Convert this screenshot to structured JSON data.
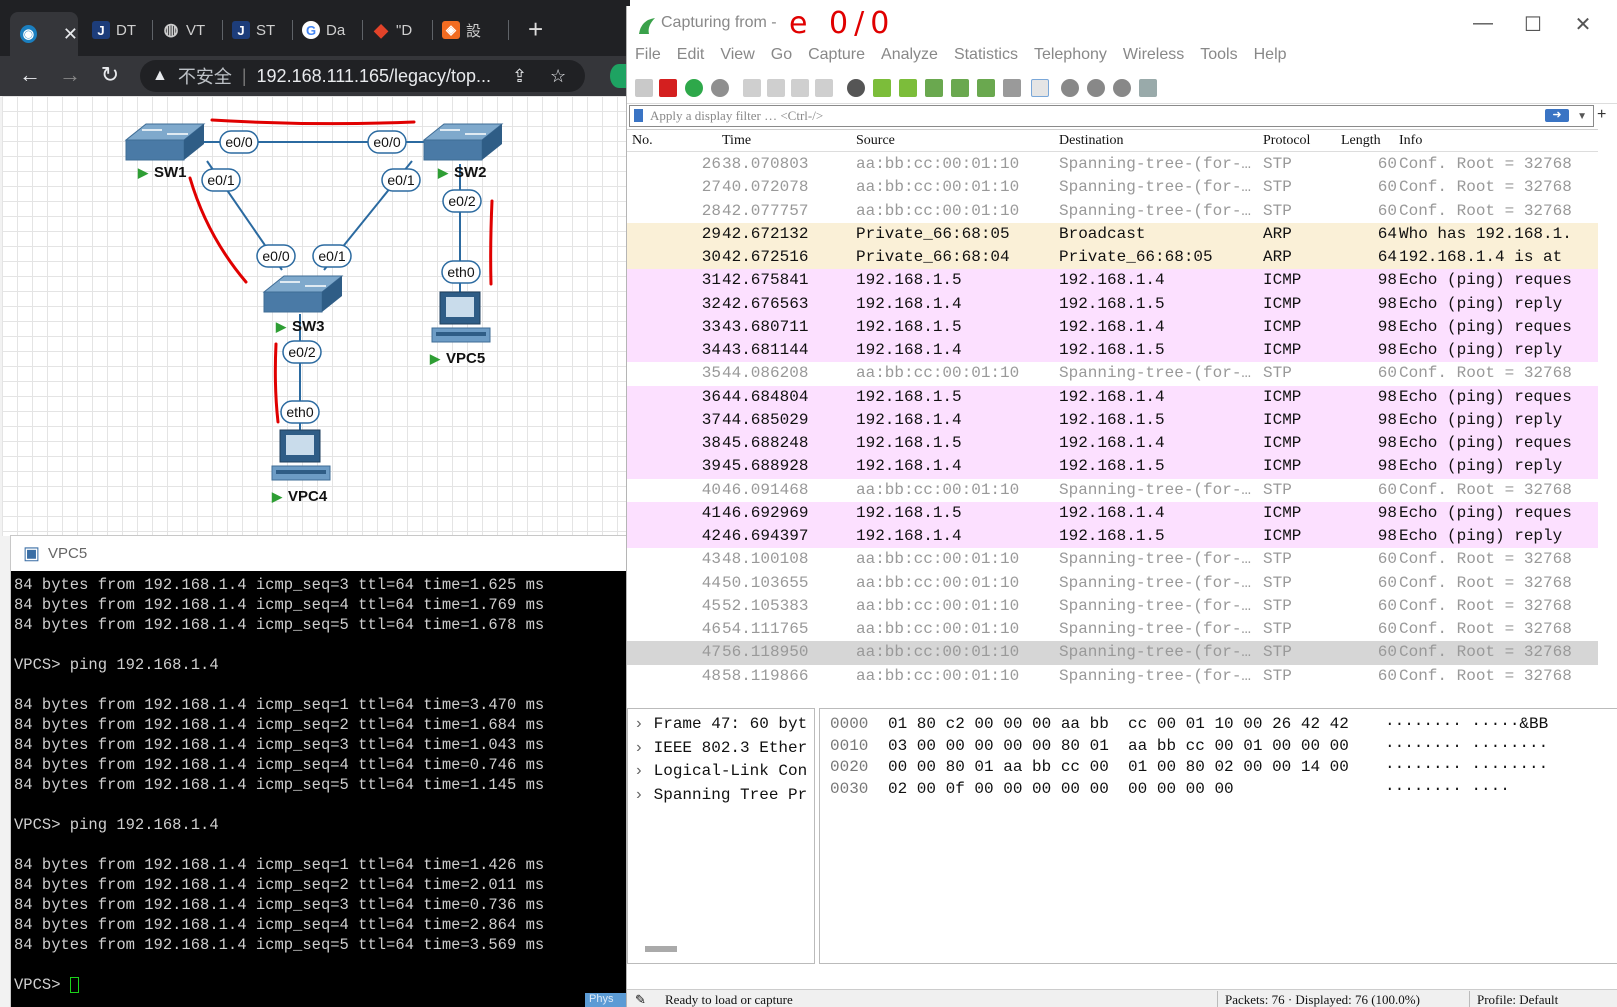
{
  "browser": {
    "tabs": [
      {
        "label": "",
        "icon": "eve-ng-icon"
      },
      {
        "label": "DT",
        "icon": "j-icon"
      },
      {
        "label": "VT",
        "icon": "globe-icon"
      },
      {
        "label": "ST",
        "icon": "j-icon"
      },
      {
        "label": "Da",
        "icon": "google-icon"
      },
      {
        "label": "\"D",
        "icon": "gitlab-icon"
      },
      {
        "label": "設",
        "icon": "orange-icon"
      }
    ],
    "insecure_label": "不安全",
    "url": "192.168.111.165/legacy/top..."
  },
  "topology": {
    "nodes": {
      "sw1": "SW1",
      "sw2": "SW2",
      "sw3": "SW3",
      "vpc5": "VPC5",
      "vpc4": "VPC4"
    },
    "ports": {
      "sw1_e00": "e0/0",
      "sw2_e00": "e0/0",
      "sw1_e01": "e0/1",
      "sw2_e01": "e0/1",
      "sw3_e00": "e0/0",
      "sw3_e01": "e0/1",
      "sw2_e02": "e0/2",
      "vpc5_eth0": "eth0",
      "sw3_e02": "e0/2",
      "vpc4_eth0": "eth0"
    },
    "colors": {
      "link": "#2b6aa0",
      "annotation": "#e00000",
      "running": "#2e9e34"
    }
  },
  "console": {
    "title": "VPC5",
    "lines": [
      "84 bytes from 192.168.1.4 icmp_seq=3 ttl=64 time=1.625 ms",
      "84 bytes from 192.168.1.4 icmp_seq=4 ttl=64 time=1.769 ms",
      "84 bytes from 192.168.1.4 icmp_seq=5 ttl=64 time=1.678 ms",
      "",
      "VPCS> ping 192.168.1.4",
      "",
      "84 bytes from 192.168.1.4 icmp_seq=1 ttl=64 time=3.470 ms",
      "84 bytes from 192.168.1.4 icmp_seq=2 ttl=64 time=1.684 ms",
      "84 bytes from 192.168.1.4 icmp_seq=3 ttl=64 time=1.043 ms",
      "84 bytes from 192.168.1.4 icmp_seq=4 ttl=64 time=0.746 ms",
      "84 bytes from 192.168.1.4 icmp_seq=5 ttl=64 time=1.145 ms",
      "",
      "VPCS> ping 192.168.1.4",
      "",
      "84 bytes from 192.168.1.4 icmp_seq=1 ttl=64 time=1.426 ms",
      "84 bytes from 192.168.1.4 icmp_seq=2 ttl=64 time=2.011 ms",
      "84 bytes from 192.168.1.4 icmp_seq=3 ttl=64 time=0.736 ms",
      "84 bytes from 192.168.1.4 icmp_seq=4 ttl=64 time=2.864 ms",
      "84 bytes from 192.168.1.4 icmp_seq=5 ttl=64 time=3.569 ms",
      ""
    ],
    "prompt": "VPCS> ",
    "phys_label": "Phys"
  },
  "wireshark": {
    "title": "Capturing from -",
    "handwritten_note": "e 0/0",
    "menu": [
      "File",
      "Edit",
      "View",
      "Go",
      "Capture",
      "Analyze",
      "Statistics",
      "Telephony",
      "Wireless",
      "Tools",
      "Help"
    ],
    "filter_placeholder": "Apply a display filter … <Ctrl-/>",
    "columns": [
      "No.",
      "Time",
      "Source",
      "Destination",
      "Protocol",
      "Length",
      "Info"
    ],
    "packets": [
      {
        "no": "26",
        "time": "38.070803",
        "src": "aa:bb:cc:00:01:10",
        "dst": "Spanning-tree-(for-…",
        "proto": "STP",
        "len": "60",
        "info": "Conf. Root = 32768",
        "kind": "stp"
      },
      {
        "no": "27",
        "time": "40.072078",
        "src": "aa:bb:cc:00:01:10",
        "dst": "Spanning-tree-(for-…",
        "proto": "STP",
        "len": "60",
        "info": "Conf. Root = 32768",
        "kind": "stp"
      },
      {
        "no": "28",
        "time": "42.077757",
        "src": "aa:bb:cc:00:01:10",
        "dst": "Spanning-tree-(for-…",
        "proto": "STP",
        "len": "60",
        "info": "Conf. Root = 32768",
        "kind": "stp"
      },
      {
        "no": "29",
        "time": "42.672132",
        "src": "Private_66:68:05",
        "dst": "Broadcast",
        "proto": "ARP",
        "len": "64",
        "info": "Who has 192.168.1.",
        "kind": "arp"
      },
      {
        "no": "30",
        "time": "42.672516",
        "src": "Private_66:68:04",
        "dst": "Private_66:68:05",
        "proto": "ARP",
        "len": "64",
        "info": "192.168.1.4 is at",
        "kind": "arp"
      },
      {
        "no": "31",
        "time": "42.675841",
        "src": "192.168.1.5",
        "dst": "192.168.1.4",
        "proto": "ICMP",
        "len": "98",
        "info": "Echo (ping) reques",
        "kind": "icmp"
      },
      {
        "no": "32",
        "time": "42.676563",
        "src": "192.168.1.4",
        "dst": "192.168.1.5",
        "proto": "ICMP",
        "len": "98",
        "info": "Echo (ping) reply",
        "kind": "icmp"
      },
      {
        "no": "33",
        "time": "43.680711",
        "src": "192.168.1.5",
        "dst": "192.168.1.4",
        "proto": "ICMP",
        "len": "98",
        "info": "Echo (ping) reques",
        "kind": "icmp"
      },
      {
        "no": "34",
        "time": "43.681144",
        "src": "192.168.1.4",
        "dst": "192.168.1.5",
        "proto": "ICMP",
        "len": "98",
        "info": "Echo (ping) reply",
        "kind": "icmp"
      },
      {
        "no": "35",
        "time": "44.086208",
        "src": "aa:bb:cc:00:01:10",
        "dst": "Spanning-tree-(for-…",
        "proto": "STP",
        "len": "60",
        "info": "Conf. Root = 32768",
        "kind": "stp"
      },
      {
        "no": "36",
        "time": "44.684804",
        "src": "192.168.1.5",
        "dst": "192.168.1.4",
        "proto": "ICMP",
        "len": "98",
        "info": "Echo (ping) reques",
        "kind": "icmp"
      },
      {
        "no": "37",
        "time": "44.685029",
        "src": "192.168.1.4",
        "dst": "192.168.1.5",
        "proto": "ICMP",
        "len": "98",
        "info": "Echo (ping) reply",
        "kind": "icmp"
      },
      {
        "no": "38",
        "time": "45.688248",
        "src": "192.168.1.5",
        "dst": "192.168.1.4",
        "proto": "ICMP",
        "len": "98",
        "info": "Echo (ping) reques",
        "kind": "icmp"
      },
      {
        "no": "39",
        "time": "45.688928",
        "src": "192.168.1.4",
        "dst": "192.168.1.5",
        "proto": "ICMP",
        "len": "98",
        "info": "Echo (ping) reply",
        "kind": "icmp"
      },
      {
        "no": "40",
        "time": "46.091468",
        "src": "aa:bb:cc:00:01:10",
        "dst": "Spanning-tree-(for-…",
        "proto": "STP",
        "len": "60",
        "info": "Conf. Root = 32768",
        "kind": "stp"
      },
      {
        "no": "41",
        "time": "46.692969",
        "src": "192.168.1.5",
        "dst": "192.168.1.4",
        "proto": "ICMP",
        "len": "98",
        "info": "Echo (ping) reques",
        "kind": "icmp"
      },
      {
        "no": "42",
        "time": "46.694397",
        "src": "192.168.1.4",
        "dst": "192.168.1.5",
        "proto": "ICMP",
        "len": "98",
        "info": "Echo (ping) reply",
        "kind": "icmp"
      },
      {
        "no": "43",
        "time": "48.100108",
        "src": "aa:bb:cc:00:01:10",
        "dst": "Spanning-tree-(for-…",
        "proto": "STP",
        "len": "60",
        "info": "Conf. Root = 32768",
        "kind": "stp"
      },
      {
        "no": "44",
        "time": "50.103655",
        "src": "aa:bb:cc:00:01:10",
        "dst": "Spanning-tree-(for-…",
        "proto": "STP",
        "len": "60",
        "info": "Conf. Root = 32768",
        "kind": "stp"
      },
      {
        "no": "45",
        "time": "52.105383",
        "src": "aa:bb:cc:00:01:10",
        "dst": "Spanning-tree-(for-…",
        "proto": "STP",
        "len": "60",
        "info": "Conf. Root = 32768",
        "kind": "stp"
      },
      {
        "no": "46",
        "time": "54.111765",
        "src": "aa:bb:cc:00:01:10",
        "dst": "Spanning-tree-(for-…",
        "proto": "STP",
        "len": "60",
        "info": "Conf. Root = 32768",
        "kind": "stp"
      },
      {
        "no": "47",
        "time": "56.118950",
        "src": "aa:bb:cc:00:01:10",
        "dst": "Spanning-tree-(for-…",
        "proto": "STP",
        "len": "60",
        "info": "Conf. Root = 32768",
        "kind": "sel"
      },
      {
        "no": "48",
        "time": "58.119866",
        "src": "aa:bb:cc:00:01:10",
        "dst": "Spanning-tree-(for-…",
        "proto": "STP",
        "len": "60",
        "info": "Conf. Root = 32768",
        "kind": "stp"
      }
    ],
    "detail": [
      "Frame 47: 60 byt",
      "IEEE 802.3 Ether",
      "Logical-Link Con",
      "Spanning Tree Pr"
    ],
    "hex": [
      {
        "off": "0000",
        "bytes": "01 80 c2 00 00 00 aa bb  cc 00 01 10 00 26 42 42",
        "ascii": "········ ·····&BB"
      },
      {
        "off": "0010",
        "bytes": "03 00 00 00 00 00 80 01  aa bb cc 00 01 00 00 00",
        "ascii": "········ ········"
      },
      {
        "off": "0020",
        "bytes": "00 00 80 01 aa bb cc 00  01 00 80 02 00 00 14 00",
        "ascii": "········ ········"
      },
      {
        "off": "0030",
        "bytes": "02 00 0f 00 00 00 00 00  00 00 00 00",
        "ascii": "········ ····"
      }
    ],
    "status": {
      "ready": "Ready to load or capture",
      "packets": "Packets: 76 · Displayed: 76 (100.0%)",
      "profile": "Profile: Default"
    }
  }
}
